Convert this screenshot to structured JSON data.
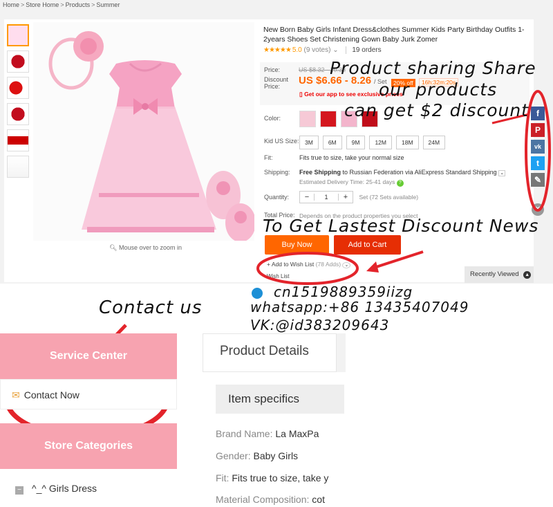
{
  "breadcrumb": [
    "Home",
    "Store Home",
    "Products",
    "Summer"
  ],
  "product": {
    "title": "New Born Baby Girls Infant Dress&clothes Summer Kids Party Birthday Outfits 1-2years Shoes Set Christening Gown Baby Jurk Zomer",
    "stars": "★★★★★",
    "rating": "5.0",
    "votes": "(9 votes)",
    "orders": "19 orders",
    "price_label": "Price:",
    "old_price": "US $8.32 - 10.32",
    "discount_label": "Discount Price:",
    "discount_price": "US $6.66 - 8.26",
    "per_set": "/ Set",
    "discount_badge": "20% off",
    "timer": "16h:32m:20s",
    "app_note": "Get our app to see exclusive prices",
    "color_label": "Color:",
    "size_label": "Kid US Size:",
    "sizes": [
      "3M",
      "6M",
      "9M",
      "12M",
      "18M",
      "24M"
    ],
    "fit_label": "Fit:",
    "fit_value": "Fits true to size, take your normal size",
    "shipping_label": "Shipping:",
    "shipping_free": "Free Shipping",
    "shipping_to": "to Russian Federation via AliExpress Standard Shipping",
    "delivery": "Estimated Delivery Time: 25-41 days",
    "quantity_label": "Quantity:",
    "quantity_value": "1",
    "quantity_minus": "−",
    "quantity_plus": "+",
    "sets_available": "Set (72 Sets available)",
    "total_label": "Total Price:",
    "total_note": "Depends on the product properties you select",
    "buy_now": "Buy Now",
    "add_to_cart": "Add to Cart",
    "wishlist": "Add to Wish List",
    "wishlist_adds": "(78 Adds)",
    "wishlist_short": "Wish List",
    "zoom_hint": "Mouse over to zoom in",
    "recently_viewed": "Recently Viewed"
  },
  "share": {
    "icons": [
      "facebook-icon",
      "pinterest-icon",
      "vk-icon",
      "twitter-icon",
      "edit-icon"
    ],
    "close": "✕"
  },
  "overlay": {
    "share_line1": "Product sharing Share",
    "share_line2": "our products",
    "share_line3": "can get $2 discount",
    "news": "To Get Lastest Discount News",
    "contact_us": "Contact us",
    "skype": "cn1519889359iizg",
    "whatsapp": "whatsapp:+86 13435407049",
    "vk": "VK:@id383209643"
  },
  "store": {
    "service_center": "Service Center",
    "contact_now": "Contact Now",
    "store_categories": "Store Categories",
    "category_1": "^_^ Girls Dress",
    "category_toggle": "−"
  },
  "details": {
    "tab": "Product Details",
    "specifics": "Item specifics",
    "rows": [
      {
        "k": "Brand Name:",
        "v": "La MaxPa"
      },
      {
        "k": "Gender:",
        "v": "Baby Girls"
      },
      {
        "k": "Fit:",
        "v": "Fits true to size, take y"
      },
      {
        "k": "Material Composition:",
        "v": "cot"
      }
    ]
  },
  "colors": {
    "accent": "#ff6600",
    "cart": "#e62e04",
    "annotation": "#e3242b",
    "pink_banner": "#f7a3b0"
  }
}
